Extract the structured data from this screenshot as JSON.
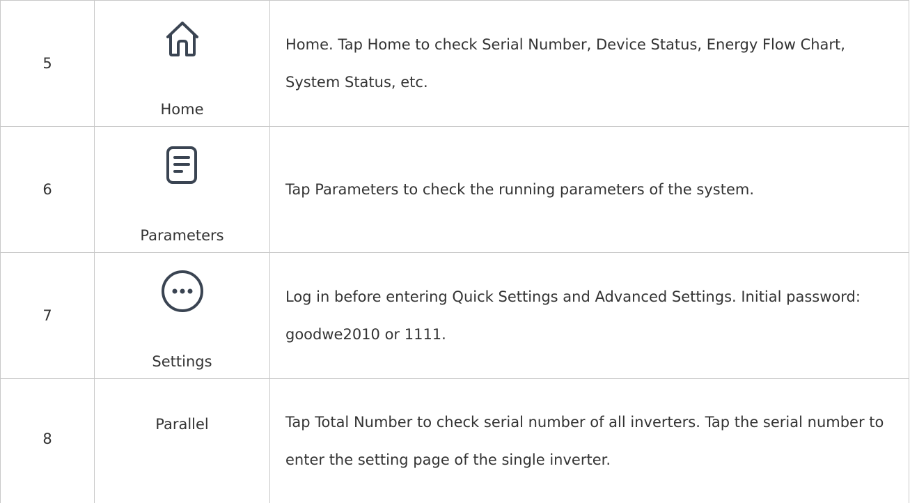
{
  "rows": [
    {
      "number": "5",
      "icon": "home-icon",
      "label": "Home",
      "description": "Home. Tap Home to check Serial Number,  Device Status,  Energy Flow Chart,  System Status,  etc."
    },
    {
      "number": "6",
      "icon": "document-icon",
      "label": "Parameters",
      "description": "Tap Parameters to check the running parameters of the system."
    },
    {
      "number": "7",
      "icon": "more-dots-icon",
      "label": "Settings",
      "description": "Log in before entering Quick Settings and Advanced Settings. Initial password:  goodwe2010 or 1111."
    },
    {
      "number": "8",
      "icon": "",
      "label": "Parallel",
      "description": "Tap Total Number to check serial number of all inverters. Tap the serial number to enter the setting page of the single inverter."
    }
  ],
  "colors": {
    "border": "#c8c8c8",
    "text": "#333333",
    "icon_stroke": "#3a4452"
  }
}
